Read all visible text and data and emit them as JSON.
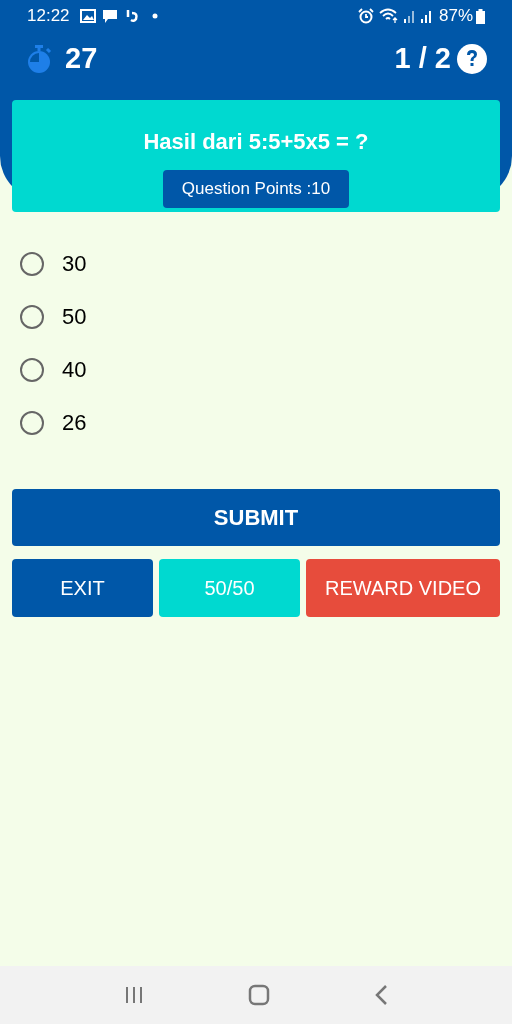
{
  "status_bar": {
    "time": "12:22",
    "battery": "87%"
  },
  "header": {
    "timer": "27",
    "progress": "1 / 2"
  },
  "question": {
    "text": "Hasil dari 5:5+5x5 = ?",
    "points": "Question Points :10"
  },
  "options": [
    {
      "label": "30",
      "selected": false
    },
    {
      "label": "50",
      "selected": false
    },
    {
      "label": "40",
      "selected": false
    },
    {
      "label": "26",
      "selected": false
    }
  ],
  "submit": "SUBMIT",
  "actions": [
    {
      "label": "EXIT",
      "kind": "exit"
    },
    {
      "label": "50/50",
      "kind": "fifty"
    },
    {
      "label": "REWARD VIDEO",
      "kind": "reward"
    }
  ]
}
